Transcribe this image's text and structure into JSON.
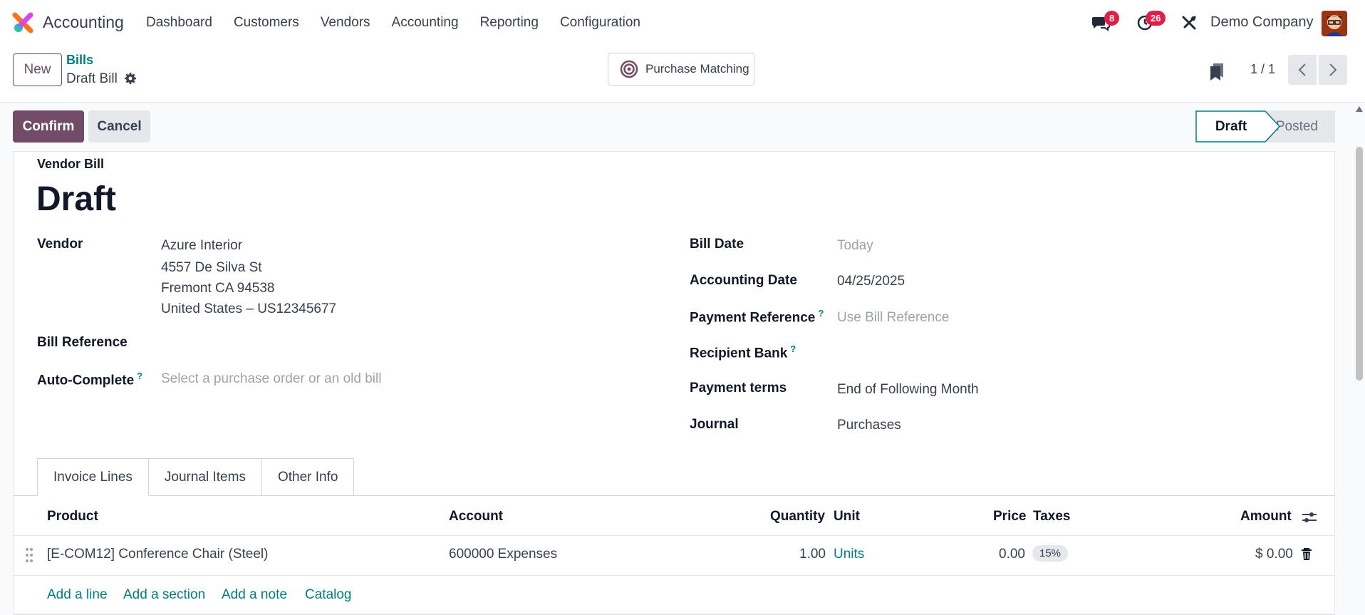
{
  "navbar": {
    "app_name": "Accounting",
    "menu": [
      "Dashboard",
      "Customers",
      "Vendors",
      "Accounting",
      "Reporting",
      "Configuration"
    ],
    "messages_count": "8",
    "activities_count": "26",
    "company": "Demo Company"
  },
  "control": {
    "new_label": "New",
    "breadcrumb_parent": "Bills",
    "breadcrumb_current": "Draft Bill",
    "purchase_matching_label": "Purchase Matching",
    "pager": "1 / 1"
  },
  "actions": {
    "confirm_label": "Confirm",
    "cancel_label": "Cancel"
  },
  "status": {
    "draft": "Draft",
    "posted": "Posted"
  },
  "form": {
    "doc_type": "Vendor Bill",
    "title": "Draft",
    "vendor_label": "Vendor",
    "vendor_name": "Azure Interior",
    "vendor_street": "4557 De Silva St",
    "vendor_city": "Fremont CA 94538",
    "vendor_country": "United States – US12345677",
    "bill_reference_label": "Bill Reference",
    "auto_complete_label": "Auto-Complete",
    "auto_complete_placeholder": "Select a purchase order or an old bill",
    "bill_date_label": "Bill Date",
    "bill_date_placeholder": "Today",
    "accounting_date_label": "Accounting Date",
    "accounting_date": "04/25/2025",
    "payment_reference_label": "Payment Reference",
    "payment_reference_placeholder": "Use Bill Reference",
    "recipient_bank_label": "Recipient Bank",
    "payment_terms_label": "Payment terms",
    "payment_terms": "End of Following Month",
    "journal_label": "Journal",
    "journal": "Purchases",
    "help_mark": "?"
  },
  "tabs": [
    "Invoice Lines",
    "Journal Items",
    "Other Info"
  ],
  "table": {
    "headers": {
      "product": "Product",
      "account": "Account",
      "quantity": "Quantity",
      "unit": "Unit",
      "price": "Price",
      "taxes": "Taxes",
      "amount": "Amount"
    },
    "rows": [
      {
        "product": "[E-COM12] Conference Chair (Steel)",
        "account": "600000 Expenses",
        "quantity": "1.00",
        "unit": "Units",
        "price": "0.00",
        "tax": "15%",
        "amount": "$ 0.00"
      }
    ],
    "add_links": [
      "Add a line",
      "Add a section",
      "Add a note",
      "Catalog"
    ]
  },
  "colors": {
    "primary": "#714b67",
    "link": "#017e84",
    "badge": "#e11d48"
  }
}
